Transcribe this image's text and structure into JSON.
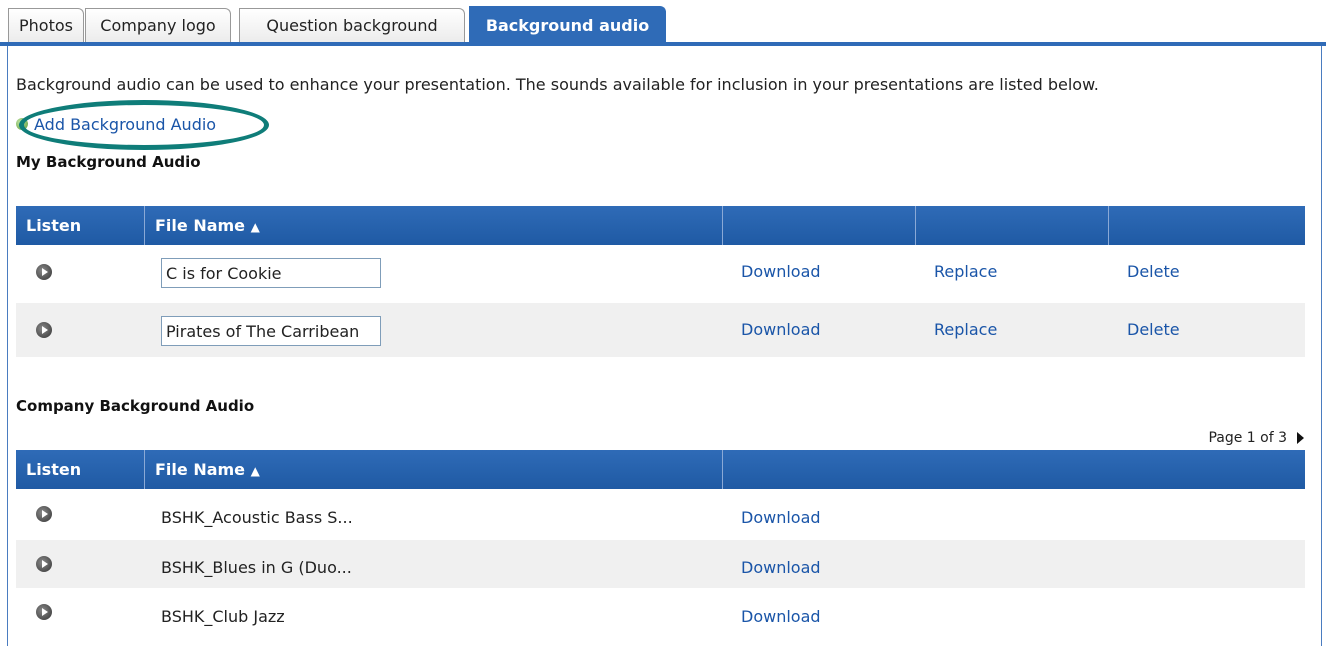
{
  "tabs": [
    {
      "label": "Photos",
      "active": false
    },
    {
      "label": "Company logo",
      "active": false
    },
    {
      "label": "Question background",
      "active": false
    },
    {
      "label": "Background audio",
      "active": true
    }
  ],
  "intro_text": "Background audio can be used to enhance your presentation. The sounds available for inclusion in your presentations are listed below.",
  "add_link": "Add Background Audio",
  "my_section": {
    "title": "My Background Audio",
    "headers": {
      "listen": "Listen",
      "file_name": "File Name",
      "sort_icon": "sort-ascending-icon"
    },
    "rows": [
      {
        "file_name": "C is for Cookie",
        "download": "Download",
        "replace": "Replace",
        "delete": "Delete"
      },
      {
        "file_name": "Pirates of The Carribean",
        "download": "Download",
        "replace": "Replace",
        "delete": "Delete"
      }
    ]
  },
  "company_section": {
    "title": "Company Background Audio",
    "pager": "Page 1 of 3",
    "headers": {
      "listen": "Listen",
      "file_name": "File Name"
    },
    "rows": [
      {
        "file_name": "BSHK_Acoustic Bass S...",
        "download": "Download"
      },
      {
        "file_name": "BSHK_Blues in G (Duo...",
        "download": "Download"
      },
      {
        "file_name": "BSHK_Club Jazz",
        "download": "Download"
      }
    ]
  },
  "colors": {
    "accent": "#2f6bb7",
    "link": "#1a55a8",
    "highlight_ring": "#0f7d79"
  }
}
